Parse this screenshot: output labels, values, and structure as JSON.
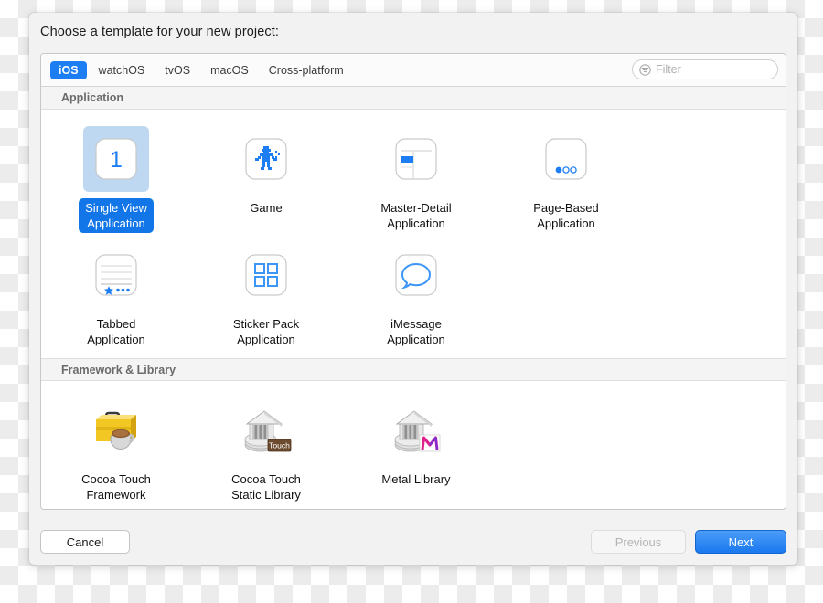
{
  "dialog": {
    "title": "Choose a template for your new project:"
  },
  "toolbar": {
    "platforms": [
      {
        "label": "iOS",
        "selected": true
      },
      {
        "label": "watchOS",
        "selected": false
      },
      {
        "label": "tvOS",
        "selected": false
      },
      {
        "label": "macOS",
        "selected": false
      },
      {
        "label": "Cross-platform",
        "selected": false
      }
    ],
    "filter": {
      "icon": "filter-icon",
      "placeholder": "Filter",
      "value": ""
    }
  },
  "sections": [
    {
      "header": "Application",
      "templates": [
        {
          "line1": "Single View",
          "line2": "Application",
          "icon": "single-view-icon",
          "selected": true
        },
        {
          "line1": "Game",
          "line2": "",
          "icon": "game-robot-icon",
          "selected": false
        },
        {
          "line1": "Master-Detail",
          "line2": "Application",
          "icon": "master-detail-icon",
          "selected": false
        },
        {
          "line1": "Page-Based",
          "line2": "Application",
          "icon": "page-based-icon",
          "selected": false
        },
        {
          "line1": "Tabbed",
          "line2": "Application",
          "icon": "tabbed-icon",
          "selected": false
        },
        {
          "line1": "Sticker Pack",
          "line2": "Application",
          "icon": "sticker-pack-icon",
          "selected": false
        },
        {
          "line1": "iMessage",
          "line2": "Application",
          "icon": "imessage-icon",
          "selected": false
        }
      ]
    },
    {
      "header": "Framework & Library",
      "templates": [
        {
          "line1": "Cocoa Touch",
          "line2": "Framework",
          "icon": "cocoa-touch-framework-icon",
          "selected": false
        },
        {
          "line1": "Cocoa Touch",
          "line2": "Static Library",
          "icon": "cocoa-touch-static-library-icon",
          "selected": false
        },
        {
          "line1": "Metal Library",
          "line2": "",
          "icon": "metal-library-icon",
          "selected": false
        }
      ]
    }
  ],
  "footer": {
    "cancel_label": "Cancel",
    "previous_label": "Previous",
    "next_label": "Next"
  },
  "colors": {
    "accent_blue": "#1d7ef4",
    "selection_fill": "#bed8f2",
    "selected_label_blue": "#1376e8",
    "badge_brown": "#6b4a2e",
    "metal_magenta": "#e0208c"
  },
  "badges": {
    "touch": "Touch",
    "metal": "M"
  }
}
